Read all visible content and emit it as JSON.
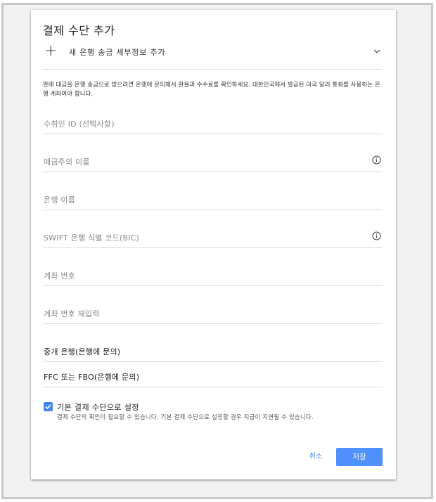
{
  "dialog": {
    "title": "결제 수단 추가",
    "add_bank_label": "새 은행 송금 세부정보 추가",
    "description": "판매 대금을 은행 송금으로 받으려면 은행에 문의해서 환율과 수수료를 확인하세요. 대한민국에서 발급된 미국 달러 통화를 사용하는 은행 계좌여야 합니다.",
    "fields": [
      {
        "label": "수취인 ID (선택사항)"
      },
      {
        "label": "예금주의 이름"
      },
      {
        "label": "은행 이름"
      },
      {
        "label": "SWIFT 은행 식별 코드(BIC)"
      },
      {
        "label": "계좌 번호"
      },
      {
        "label": "계좌 번호 재입력"
      },
      {
        "label": "중개 은행(은행에 문의)"
      },
      {
        "label": "FFC 또는 FBO(은행에 문의)"
      }
    ],
    "default_checkbox": {
      "label": "기본 결제 수단으로 설정",
      "helper": "결제 수단의 확인이 필요할 수 있습니다. 기본 결제 수단으로 설정할 경우 지급이 지연될 수 있습니다.",
      "checked": true
    },
    "cancel_label": "취소",
    "save_label": "저장"
  },
  "colors": {
    "accent": "#4285f4",
    "save_button": "#4d90fe",
    "frame": "#c8c8c8",
    "backdrop": "#f1f1f1"
  },
  "icons": {
    "add": "plus-icon",
    "expand": "chevron-down-icon",
    "info": "info-icon",
    "check": "check-icon"
  }
}
